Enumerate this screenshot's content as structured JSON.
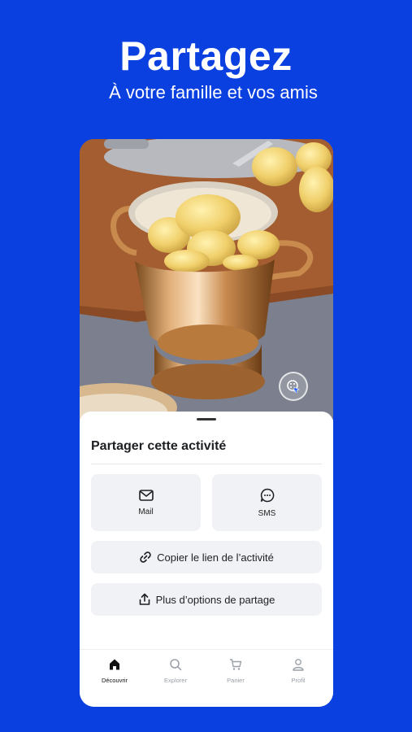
{
  "promo": {
    "headline": "Partagez",
    "subheadline": "À votre famille et vos amis"
  },
  "share_sheet": {
    "title": "Partager cette activité",
    "options": {
      "mail_label": "Mail",
      "sms_label": "SMS",
      "copy_link_label": "Copier le lien de l’activité",
      "more_options_label": "Plus d’options de partage"
    }
  },
  "tabbar": {
    "items": [
      {
        "label": "Découvrir",
        "icon": "home-icon",
        "active": true
      },
      {
        "label": "Explorer",
        "icon": "search-icon",
        "active": false
      },
      {
        "label": "Panier",
        "icon": "cart-icon",
        "active": false
      },
      {
        "label": "Profil",
        "icon": "user-icon",
        "active": false
      }
    ]
  },
  "colors": {
    "background": "#0a3fe0",
    "sheet": "#ffffff",
    "tile": "#f1f2f5",
    "accent": "#1a56ff"
  }
}
